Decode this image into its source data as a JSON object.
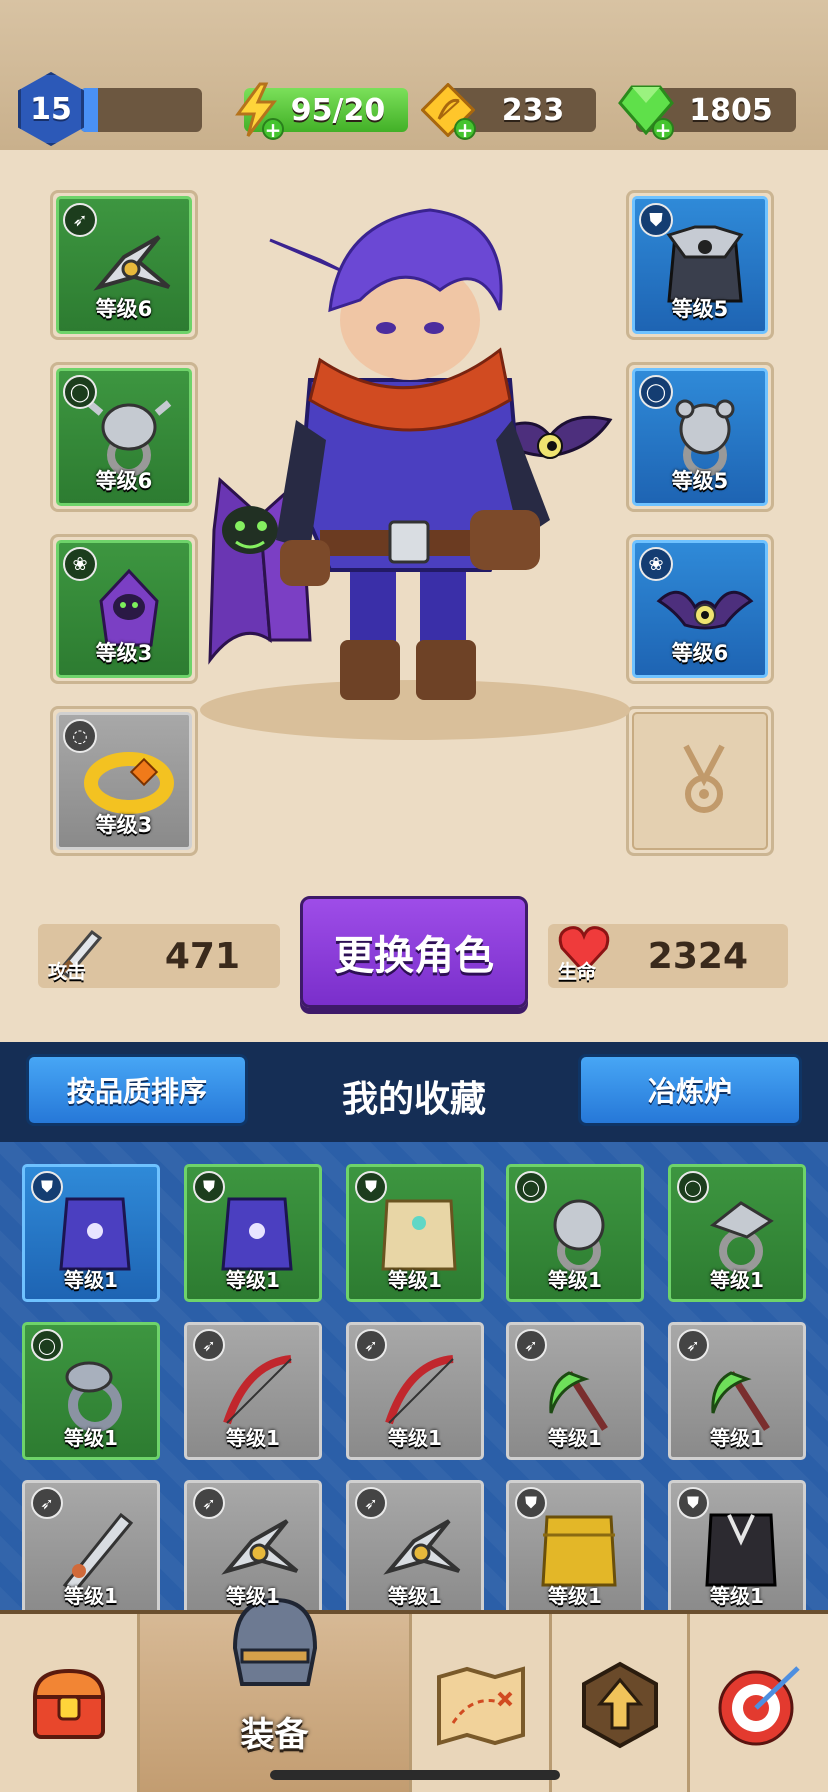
{
  "top_bar": {
    "level": "15",
    "xp_fraction": 0.15,
    "energy": "95/20",
    "coins": "233",
    "gems": "1805"
  },
  "equipment": {
    "left": [
      {
        "label": "等级6",
        "type_icon": "bow-icon",
        "art": "shuriken-icon",
        "rarity": "green"
      },
      {
        "label": "等级6",
        "type_icon": "ring-icon",
        "art": "bull-ring-icon",
        "rarity": "green"
      },
      {
        "label": "等级3",
        "type_icon": "paw-icon",
        "art": "reaper-pet-icon",
        "rarity": "green"
      },
      {
        "label": "等级3",
        "type_icon": "bracelet-icon",
        "art": "gold-bracelet-icon",
        "rarity": "gray"
      }
    ],
    "right": [
      {
        "label": "等级5",
        "type_icon": "armor-icon",
        "art": "dark-armor-icon",
        "rarity": "blue"
      },
      {
        "label": "等级5",
        "type_icon": "ring-icon",
        "art": "bear-ring-icon",
        "rarity": "blue"
      },
      {
        "label": "等级6",
        "type_icon": "paw-icon",
        "art": "bat-pet-icon",
        "rarity": "blue"
      },
      {
        "label": "",
        "type_icon": "necklace-icon",
        "art": "empty-necklace-slot",
        "rarity": "empty"
      }
    ]
  },
  "stats": {
    "attack_label": "攻击",
    "attack_value": "471",
    "change_button": "更换角色",
    "hp_label": "生命",
    "hp_value": "2324"
  },
  "collection": {
    "sort_button": "按品质排序",
    "title": "我的收藏",
    "forge_button": "冶炼炉",
    "items": [
      {
        "label": "等级1",
        "type_icon": "armor-icon",
        "art": "purple-robe-icon",
        "rarity": "blue"
      },
      {
        "label": "等级1",
        "type_icon": "armor-icon",
        "art": "purple-robe-icon",
        "rarity": "green"
      },
      {
        "label": "等级1",
        "type_icon": "armor-icon",
        "art": "gold-vest-icon",
        "rarity": "green"
      },
      {
        "label": "等级1",
        "type_icon": "ring-icon",
        "art": "bear-ring-icon",
        "rarity": "green"
      },
      {
        "label": "等级1",
        "type_icon": "ring-icon",
        "art": "eagle-ring-icon",
        "rarity": "green"
      },
      {
        "label": "等级1",
        "type_icon": "ring-icon",
        "art": "snake-ring-icon",
        "rarity": "green"
      },
      {
        "label": "等级1",
        "type_icon": "bow-icon",
        "art": "red-bow-icon",
        "rarity": "gray"
      },
      {
        "label": "等级1",
        "type_icon": "bow-icon",
        "art": "red-bow-icon",
        "rarity": "gray"
      },
      {
        "label": "等级1",
        "type_icon": "bow-icon",
        "art": "scythe-icon",
        "rarity": "gray"
      },
      {
        "label": "等级1",
        "type_icon": "bow-icon",
        "art": "scythe-icon",
        "rarity": "gray"
      },
      {
        "label": "等级1",
        "type_icon": "bow-icon",
        "art": "saw-sword-icon",
        "rarity": "gray"
      },
      {
        "label": "等级1",
        "type_icon": "bow-icon",
        "art": "shuriken-icon",
        "rarity": "gray"
      },
      {
        "label": "等级1",
        "type_icon": "bow-icon",
        "art": "shuriken-icon",
        "rarity": "gray"
      },
      {
        "label": "等级1",
        "type_icon": "armor-icon",
        "art": "gold-armor-icon",
        "rarity": "gray"
      },
      {
        "label": "等级1",
        "type_icon": "armor-icon",
        "art": "black-vest-icon",
        "rarity": "gray"
      }
    ]
  },
  "bottom_nav": {
    "tabs": [
      {
        "name": "shop-tab",
        "icon": "chest-icon",
        "label": ""
      },
      {
        "name": "equipment-tab",
        "icon": "helmet-icon",
        "label": "装备"
      },
      {
        "name": "map-tab",
        "icon": "map-icon",
        "label": ""
      },
      {
        "name": "upgrade-tab",
        "icon": "upgrade-arrow-icon",
        "label": ""
      },
      {
        "name": "challenge-tab",
        "icon": "target-icon",
        "label": ""
      }
    ]
  }
}
